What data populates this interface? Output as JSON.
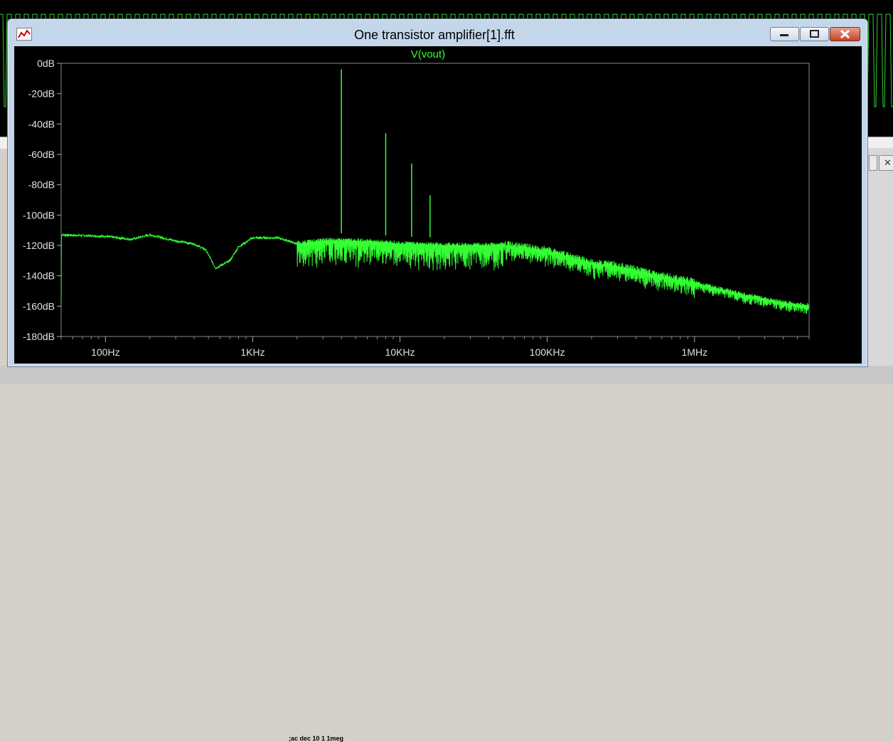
{
  "window": {
    "title": "One transistor amplifier[1].fft"
  },
  "netlist_directive": ";ac dec 10 1 1meg",
  "chart_data": {
    "type": "line",
    "title": "V(vout)",
    "x_scale": "log",
    "x_ticks": [
      "100Hz",
      "1KHz",
      "10KHz",
      "100KHz",
      "1MHz"
    ],
    "y_ticks": [
      "0dB",
      "-20dB",
      "-40dB",
      "-60dB",
      "-80dB",
      "-100dB",
      "-120dB",
      "-140dB",
      "-160dB",
      "-180dB"
    ],
    "xlim": [
      50,
      6000000
    ],
    "ylim": [
      -180,
      0
    ],
    "series": [
      {
        "name": "V(vout)",
        "color": "#33ff33",
        "noise_floor": [
          [
            50,
            -113
          ],
          [
            100,
            -114
          ],
          [
            150,
            -116
          ],
          [
            200,
            -113
          ],
          [
            300,
            -117
          ],
          [
            400,
            -119
          ],
          [
            480,
            -123
          ],
          [
            560,
            -135
          ],
          [
            700,
            -130
          ],
          [
            800,
            -121
          ],
          [
            1000,
            -115
          ],
          [
            1500,
            -115
          ],
          [
            2000,
            -119
          ],
          [
            3000,
            -117
          ],
          [
            5000,
            -117
          ],
          [
            10000,
            -119
          ],
          [
            20000,
            -120
          ],
          [
            50000,
            -120
          ],
          [
            100000,
            -124
          ],
          [
            200000,
            -132
          ],
          [
            300000,
            -134
          ],
          [
            500000,
            -139
          ],
          [
            1000000,
            -145
          ],
          [
            2000000,
            -152
          ],
          [
            4000000,
            -158
          ],
          [
            6000000,
            -160
          ]
        ],
        "peaks": [
          [
            4000,
            -4
          ],
          [
            8000,
            -46
          ],
          [
            12000,
            -66
          ],
          [
            16000,
            -87
          ]
        ]
      }
    ]
  }
}
